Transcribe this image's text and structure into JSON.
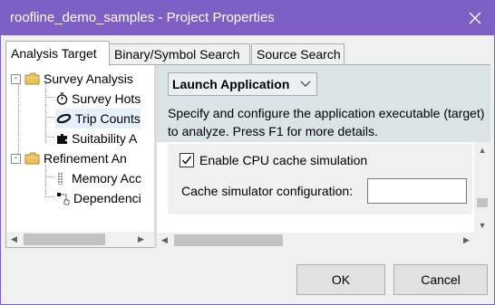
{
  "window": {
    "title": "roofline_demo_samples - Project Properties",
    "title_bar_color": "#7e5fc4"
  },
  "tabs": [
    {
      "label": "Analysis Target",
      "active": true
    },
    {
      "label": "Binary/Symbol Search",
      "active": false
    },
    {
      "label": "Source Search",
      "active": false
    }
  ],
  "tree": {
    "items": [
      {
        "label": "Survey Analysis",
        "icon": "folder-icon",
        "expander": "-"
      },
      {
        "label": "Survey Hots",
        "icon": "stopwatch-icon"
      },
      {
        "label": "Trip Counts",
        "icon": "loop-icon"
      },
      {
        "label": "Suitability A",
        "icon": "puzzle-icon"
      },
      {
        "label": "Refinement An",
        "icon": "folder-icon",
        "expander": "-"
      },
      {
        "label": "Memory Acc",
        "icon": "memory-icon"
      },
      {
        "label": "Dependenci",
        "icon": "dependency-icon"
      }
    ]
  },
  "panel": {
    "dropdown_value": "Launch Application",
    "description": "Specify and configure the application executable (target) to analyze. Press F1 for more details.",
    "checkbox_label": "Enable CPU cache simulation",
    "checkbox_checked": true,
    "config_label": "Cache simulator configuration:",
    "config_value": "",
    "header_color": "#dae3e8"
  },
  "buttons": {
    "ok": "OK",
    "cancel": "Cancel"
  }
}
